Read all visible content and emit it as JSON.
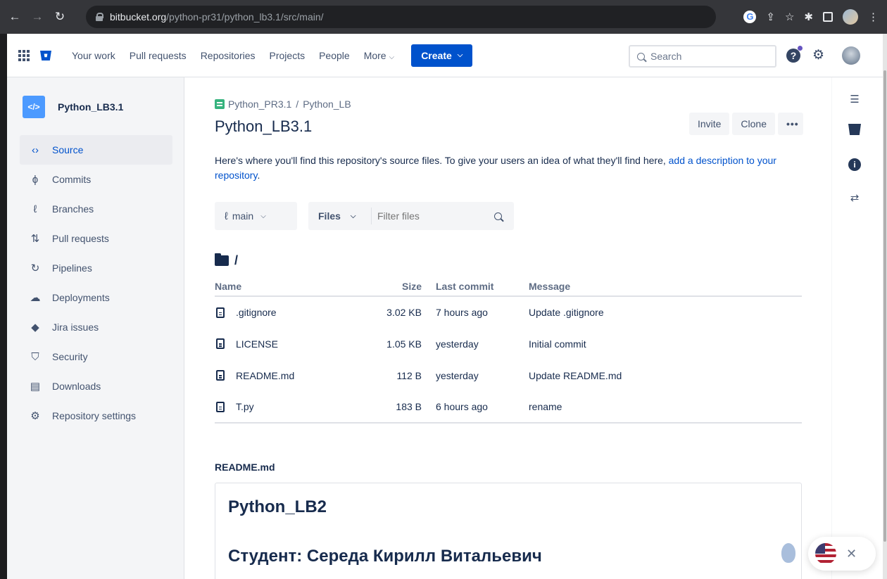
{
  "browser": {
    "url_host": "bitbucket.org",
    "url_path": "/python-pr31/python_lb3.1/src/main/"
  },
  "topnav": {
    "links": [
      {
        "label": "Your work"
      },
      {
        "label": "Pull requests"
      },
      {
        "label": "Repositories"
      },
      {
        "label": "Projects"
      },
      {
        "label": "People"
      },
      {
        "label": "More"
      }
    ],
    "create_label": "Create",
    "search_placeholder": "Search"
  },
  "sidebar": {
    "repo_avatar": "</>",
    "repo_name": "Python_LB3.1",
    "items": [
      {
        "label": "Source",
        "icon": "code-icon",
        "glyph": "‹›",
        "active": true
      },
      {
        "label": "Commits",
        "icon": "commit-icon",
        "glyph": "ϕ"
      },
      {
        "label": "Branches",
        "icon": "branch-icon",
        "glyph": "ℓ"
      },
      {
        "label": "Pull requests",
        "icon": "pull-request-icon",
        "glyph": "⇅"
      },
      {
        "label": "Pipelines",
        "icon": "pipelines-icon",
        "glyph": "↻"
      },
      {
        "label": "Deployments",
        "icon": "deployments-icon",
        "glyph": "☁"
      },
      {
        "label": "Jira issues",
        "icon": "jira-icon",
        "glyph": "◆"
      },
      {
        "label": "Security",
        "icon": "shield-icon",
        "glyph": "⛉"
      },
      {
        "label": "Downloads",
        "icon": "file-icon",
        "glyph": "▤"
      },
      {
        "label": "Repository settings",
        "icon": "gear-icon",
        "glyph": "⚙"
      }
    ]
  },
  "main": {
    "breadcrumb": {
      "workspace": "Python_PR3.1",
      "separator": "/",
      "project": "Python_LB"
    },
    "title": "Python_LB3.1",
    "invite_label": "Invite",
    "clone_label": "Clone",
    "more_label": "•••",
    "description_text": "Here's where you'll find this repository's source files. To give your users an idea of what they'll find here, ",
    "description_link": "add a description to your repository",
    "description_end": ".",
    "branch": "main",
    "files_dropdown": "Files",
    "filter_placeholder": "Filter files",
    "path": "/",
    "table": {
      "headers": {
        "name": "Name",
        "size": "Size",
        "last_commit": "Last commit",
        "message": "Message"
      },
      "rows": [
        {
          "name": ".gitignore",
          "size": "3.02 KB",
          "last_commit": "7 hours ago",
          "message": "Update .gitignore"
        },
        {
          "name": "LICENSE",
          "size": "1.05 KB",
          "last_commit": "yesterday",
          "message": "Initial commit"
        },
        {
          "name": "README.md",
          "size": "112 B",
          "last_commit": "yesterday",
          "message": "Update README.md"
        },
        {
          "name": "T.py",
          "size": "183 B",
          "last_commit": "6 hours ago",
          "message": "rename"
        }
      ]
    },
    "readme_label": "README.md",
    "readme": {
      "h1": "Python_LB2",
      "h2": "Студент: Середа Кирилл Витальевич"
    }
  },
  "colors": {
    "brand": "#0052CC",
    "text": "#172B4D",
    "sidebar_bg": "#F4F5F7"
  }
}
